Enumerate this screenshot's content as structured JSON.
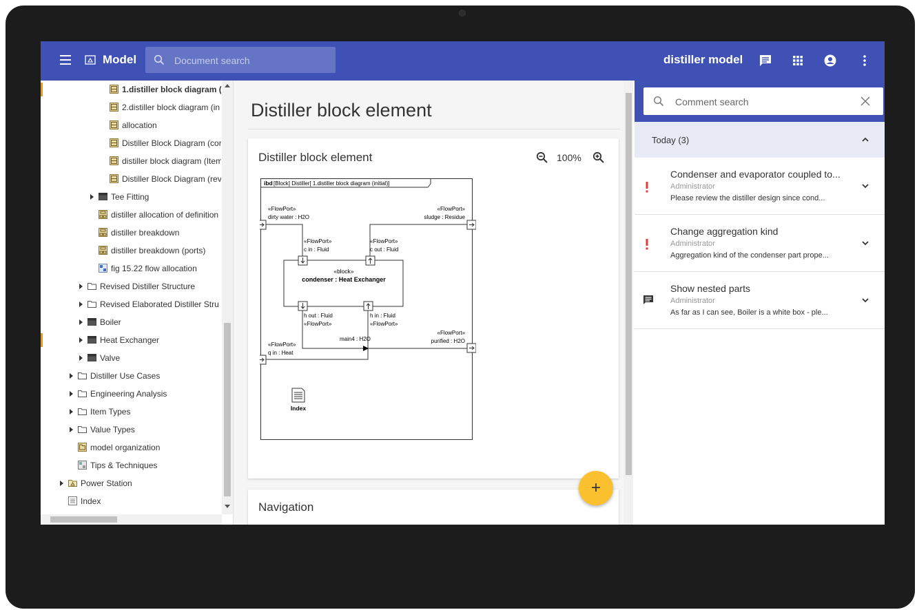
{
  "header": {
    "app_title": "Model",
    "search_placeholder": "Document search",
    "project_name": "distiller model"
  },
  "tree": {
    "items": [
      {
        "label": "1.distiller block diagram (",
        "bold": true,
        "marker": true
      },
      {
        "label": "2.distiller block diagram (in"
      },
      {
        "label": "allocation"
      },
      {
        "label": "Distiller Block Diagram (cor"
      },
      {
        "label": "distiller block diagram (Item"
      },
      {
        "label": "Distiller Block Diagram (rev"
      },
      {
        "label": "Tee Fitting"
      },
      {
        "label": "distiller allocation of definition"
      },
      {
        "label": "distiller breakdown"
      },
      {
        "label": "distiller breakdown (ports)"
      },
      {
        "label": "fig 15.22 flow allocation"
      },
      {
        "label": "Revised Distiller Structure"
      },
      {
        "label": "Revised Elaborated Distiller Stru"
      },
      {
        "label": "Boiler"
      },
      {
        "label": "Heat Exchanger",
        "marker": true
      },
      {
        "label": "Valve"
      },
      {
        "label": "Distiller Use Cases"
      },
      {
        "label": "Engineering Analysis"
      },
      {
        "label": "Item Types"
      },
      {
        "label": "Value Types"
      },
      {
        "label": "model organization"
      },
      {
        "label": "Tips & Techniques"
      },
      {
        "label": "Power Station"
      },
      {
        "label": "Index"
      }
    ]
  },
  "main": {
    "document_title": "Distiller block element",
    "card_title": "Distiller block element",
    "zoom_level": "100%",
    "navigation_title": "Navigation",
    "fab_label": "+"
  },
  "diagram": {
    "frame_keyword": "ibd",
    "frame_title": "[Block] Distiller[ 1.distiller block diagram (initial)]",
    "stereotype_flowport": "«FlowPort»",
    "stereotype_block": "«block»",
    "block_name": "condenser : Heat Exchanger",
    "port_dirty_water": "dirty water : H2O",
    "port_sludge": "sludge : Residue",
    "port_c_in": "c in : Fluid",
    "port_c_out": "c out : Fluid",
    "port_h_out": "h out : Fluid",
    "port_h_in": "h in : Fluid",
    "connector_main4": "main4 : H2O",
    "port_purified": "purified : H2O",
    "port_q_in": "q in : Heat",
    "index_label": "Index"
  },
  "comments": {
    "search_placeholder": "Comment search",
    "group_label": "Today",
    "group_count": "(3)",
    "items": [
      {
        "title": "Condenser and evaporator coupled to...",
        "author": "Administrator",
        "body": "Please review the distiller design since cond..."
      },
      {
        "title": "Change aggregation kind",
        "author": "Administrator",
        "body": "Aggregation kind of the condenser part prope..."
      },
      {
        "title": "Show nested parts",
        "author": "Administrator",
        "body": "As far as I can see, Boiler is a white box - ple..."
      }
    ]
  },
  "colors": {
    "primary": "#3f51b5",
    "accent": "#fbc02d",
    "alert": "#e53935",
    "tree_marker": "#f59a00"
  }
}
